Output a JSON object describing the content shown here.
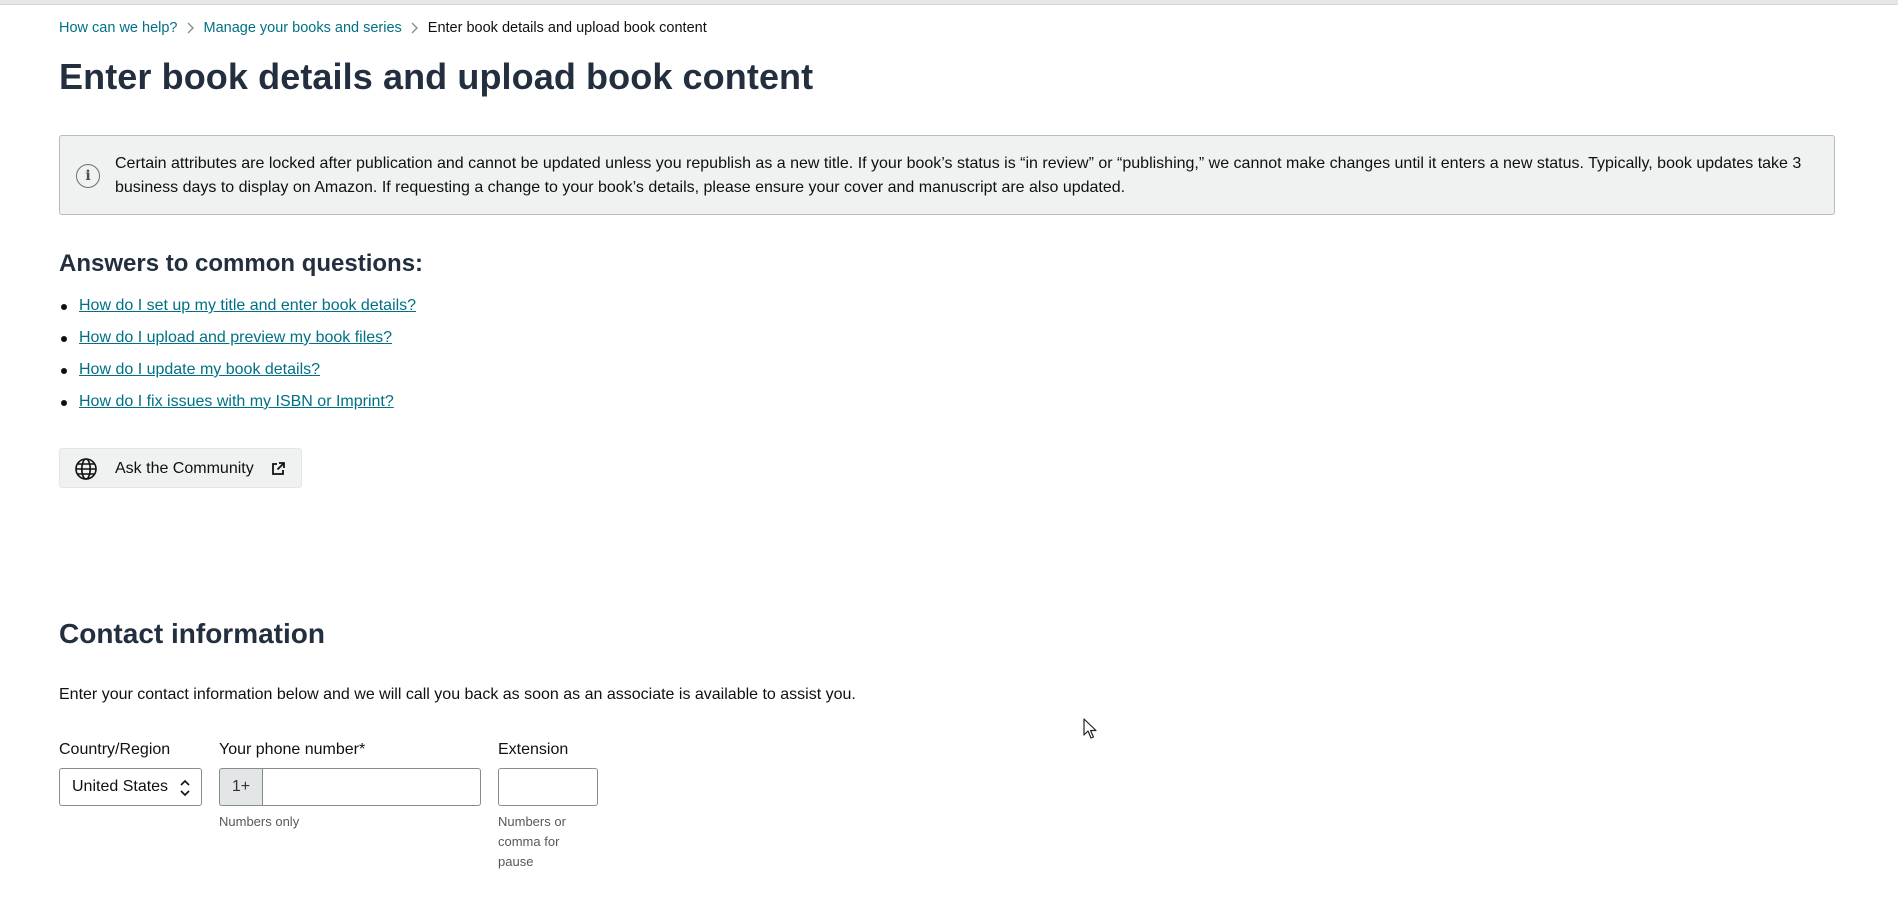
{
  "breadcrumb": {
    "items": [
      "How can we help?",
      "Manage your books and series"
    ],
    "current": "Enter book details and upload book content"
  },
  "page": {
    "title": "Enter book details and upload book content"
  },
  "alert": {
    "icon": "info-icon",
    "text": "Certain attributes are locked after publication and cannot be updated unless you republish as a new title. If your book’s status is “in review” or “publishing,” we cannot make changes until it enters a new status. Typically, book updates take 3 business days to display on Amazon. If requesting a change to your book’s details, please ensure your cover and manuscript are also updated."
  },
  "faq": {
    "heading": "Answers to common questions:",
    "links": [
      "How do I set up my title and enter book details?",
      "How do I upload and preview my book files?",
      "How do I update my book details?",
      "How do I fix issues with my ISBN or Imprint?"
    ]
  },
  "community": {
    "label": "Ask the Community",
    "icon": "globe-icon",
    "external_icon": "external-link-icon"
  },
  "contact": {
    "heading": "Contact information",
    "description": "Enter your contact information below and we will call you back as soon as an associate is available to assist you.",
    "country": {
      "label": "Country/Region",
      "value": "United States"
    },
    "phone": {
      "label": "Your phone number*",
      "prefix": "1+",
      "value": "",
      "hint": "Numbers only"
    },
    "extension": {
      "label": "Extension",
      "value": "",
      "hint": "Numbers or comma for pause"
    }
  },
  "colors": {
    "link": "#007185",
    "heading": "#232f3e",
    "alert_bg": "#f0f2f2",
    "text": "#0f1111"
  }
}
